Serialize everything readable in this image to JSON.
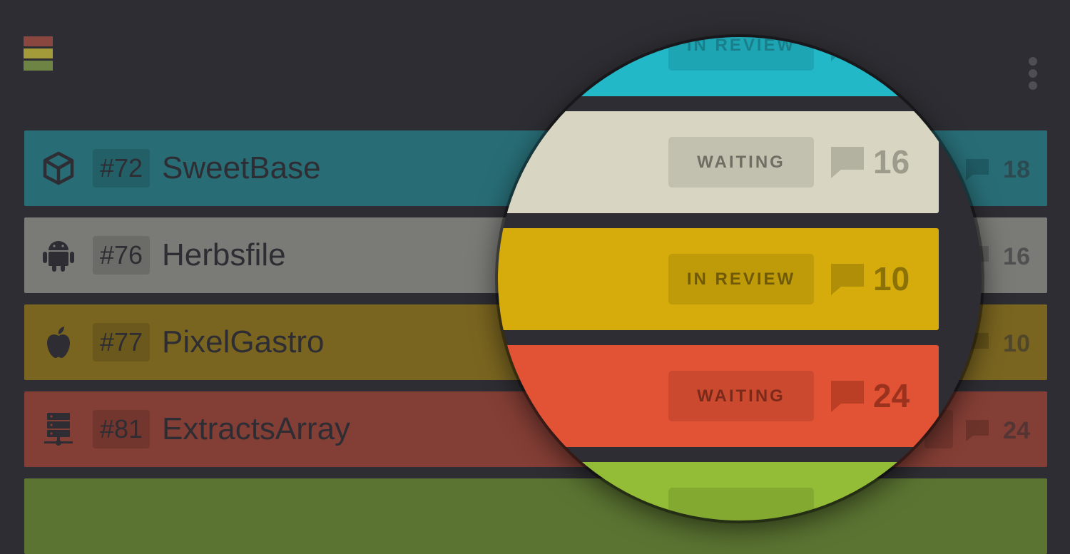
{
  "app": {
    "logo_colors": [
      "#8a4740",
      "#a39a3a",
      "#6e8444"
    ]
  },
  "projects": [
    {
      "number": "#72",
      "name": "SweetBase",
      "platform": "unity-icon",
      "comments": "18",
      "color": "#286d76"
    },
    {
      "number": "#76",
      "name": "Herbsfile",
      "platform": "android-icon",
      "comments": "16",
      "color": "#7a7a76"
    },
    {
      "number": "#77",
      "name": "PixelGastro",
      "platform": "apple-icon",
      "comments": "10",
      "color": "#7a6520"
    },
    {
      "number": "#81",
      "name": "ExtractsArray",
      "platform": "server-icon",
      "comments": "24",
      "color": "#833e35"
    },
    {
      "color": "#5b7432"
    }
  ],
  "magnified": [
    {
      "status": "IN REVIEW",
      "color": "#22b8c8"
    },
    {
      "status": "WAITING",
      "comments": "16",
      "color": "#d8d6c2"
    },
    {
      "status": "IN REVIEW",
      "comments": "10",
      "color": "#d5ac0b"
    },
    {
      "status": "WAITING",
      "comments": "24",
      "color": "#e25335"
    },
    {
      "color": "#94bd37"
    }
  ]
}
